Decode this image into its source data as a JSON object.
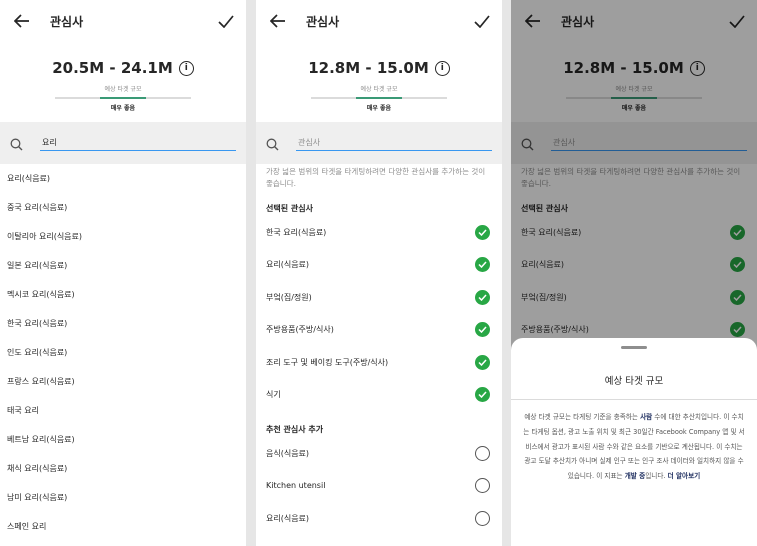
{
  "header": {
    "title": "관심사"
  },
  "icons": {
    "back": "arrow-left-icon",
    "done": "checkmark-icon",
    "info": "info-icon",
    "search": "search-icon",
    "selected": "check-circle-icon",
    "unselected": "empty-circle-icon"
  },
  "colors": {
    "meter_fill": "#3a9a76",
    "selected_check": "#28a745",
    "search_underline": "#3897f0",
    "link": "#1a2a5c"
  },
  "panel1": {
    "audience_range": "20.5M - 24.1M",
    "audience_label": "예상 타겟 규모",
    "quality": "매우 좋음",
    "search_value": "요리",
    "results": [
      "요리(식음료)",
      "중국 요리(식음료)",
      "이탈리아 요리(식음료)",
      "일본 요리(식음료)",
      "멕시코 요리(식음료)",
      "한국 요리(식음료)",
      "인도 요리(식음료)",
      "프랑스 요리(식음료)",
      "태국 요리",
      "베트남 요리(식음료)",
      "채식 요리(식음료)",
      "남미 요리(식음료)",
      "스페인 요리"
    ]
  },
  "panel2": {
    "audience_range": "12.8M - 15.0M",
    "audience_label": "예상 타겟 규모",
    "quality": "매우 좋음",
    "search_placeholder": "관심사",
    "hint": "가장 넓은 범위의 타겟을 타게팅하려면 다양한 관심사를 추가하는 것이 좋습니다.",
    "selected_title": "선택된 관심사",
    "selected": [
      "한국 요리(식음료)",
      "요리(식음료)",
      "부엌(집/정원)",
      "주방용품(주방/식사)",
      "조리 도구 및 베이킹 도구(주방/식사)",
      "식기"
    ],
    "suggested_title": "추천 관심사 추가",
    "suggested": [
      "음식(식음료)",
      "Kitchen utensil",
      "요리(식음료)"
    ]
  },
  "panel3": {
    "sheet_title": "예상 타겟 규모",
    "body_1": "예상 타겟 규모는 타게팅 기준을 충족하는 ",
    "body_bold_1": "사람",
    "body_2": " 수에 대한 추산치입니다. 이 수치는 타게팅 옵션, 광고 노출 위치 및 최근 30일간 Facebook Company 앱 및 서비스에서 광고가 표시된 사람 수와 같은 요소를 기반으로 계산됩니다. 이 수치는 광고 도달 추산치가 아니며 실제 인구 또는 인구 조사 데이터와 일치하지 않을 수 있습니다. 이 지표는 ",
    "body_bold_2": "개발 중",
    "body_3": "입니다. ",
    "link": "더 알아보기"
  }
}
